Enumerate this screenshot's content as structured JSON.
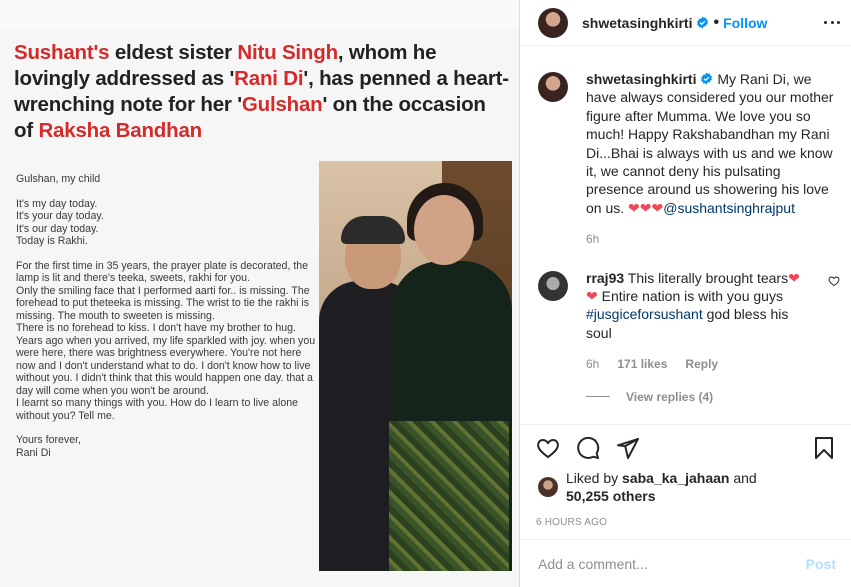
{
  "image": {
    "headline": {
      "parts": [
        {
          "text": "Sushant's",
          "red": true
        },
        {
          "text": " eldest sister ",
          "red": false
        },
        {
          "text": "Nitu Singh",
          "red": true
        },
        {
          "text": ", whom he lovingly addressed as '",
          "red": false
        },
        {
          "text": "Rani Di",
          "red": true
        },
        {
          "text": "', has penned a heart-wrenching note for her '",
          "red": false
        },
        {
          "text": "Gulshan",
          "red": true
        },
        {
          "text": "' on the occasion of ",
          "red": false
        },
        {
          "text": "Raksha Bandhan",
          "red": true
        }
      ]
    },
    "letter": [
      "Gulshan, my child",
      "It's my day today.\nIt's your day today.\nIt's our day today.\nToday is Rakhi.",
      "For the first time in 35 years, the prayer plate is decorated, the lamp is lit and there's teeka, sweets, rakhi for you.\nOnly the smiling face that I performed aarti for.. is missing. The forehead to put theteeka is missing. The wrist to tie the rakhi is missing. The mouth to sweeten is missing.\nThere is no forehead to kiss. I don't have my brother to hug.\nYears ago when you arrived, my life sparkled with joy. when you were here, there was brightness everywhere. You're not here now and I don't understand what to do. I don't know how to live without you. I didn't think that this would happen one day. that a day will come when you won't be around.\nI learnt so many things with you. How do I learn to live alone without you? Tell me.",
      "Yours forever,\nRani Di"
    ]
  },
  "header": {
    "username": "shwetasinghkirti",
    "separator": "•",
    "follow_label": "Follow"
  },
  "caption": {
    "username": "shwetasinghkirti",
    "text": " My Rani Di, we have always considered you our mother figure after Mumma. We love you so much! Happy Rakshabandhan my Rani Di...Bhai is always with us and we know it, we cannot deny his pulsating presence around us showering his love on us. ",
    "hearts": "❤❤❤",
    "mention": "@sushantsinghrajput",
    "time": "6h"
  },
  "comment": {
    "username": "rraj93",
    "text_before": " This literally brought tears",
    "heart1": "❤",
    "heart2": "❤",
    "text_after": " Entire nation is with you guys ",
    "hashtag": "#jusgiceforsushant",
    "text_end": " god bless his soul",
    "time": "6h",
    "likes": "171 likes",
    "reply_label": "Reply",
    "view_replies": "View replies (4)"
  },
  "likes": {
    "prefix": "Liked by ",
    "user": "saba_ka_jahaan",
    "and": " and",
    "others": "50,255 others"
  },
  "timestamp": "6 HOURS AGO",
  "add_comment": {
    "placeholder": "Add a comment...",
    "post_label": "Post"
  },
  "colors": {
    "accent": "#0095f6",
    "headline_red": "#d42a2a",
    "heart": "#ed4956",
    "link": "#00376b",
    "muted": "#8e8e8e"
  },
  "icons": [
    "heart-icon",
    "comment-icon",
    "share-icon",
    "bookmark-icon",
    "more-options-icon",
    "verified-badge-icon"
  ]
}
